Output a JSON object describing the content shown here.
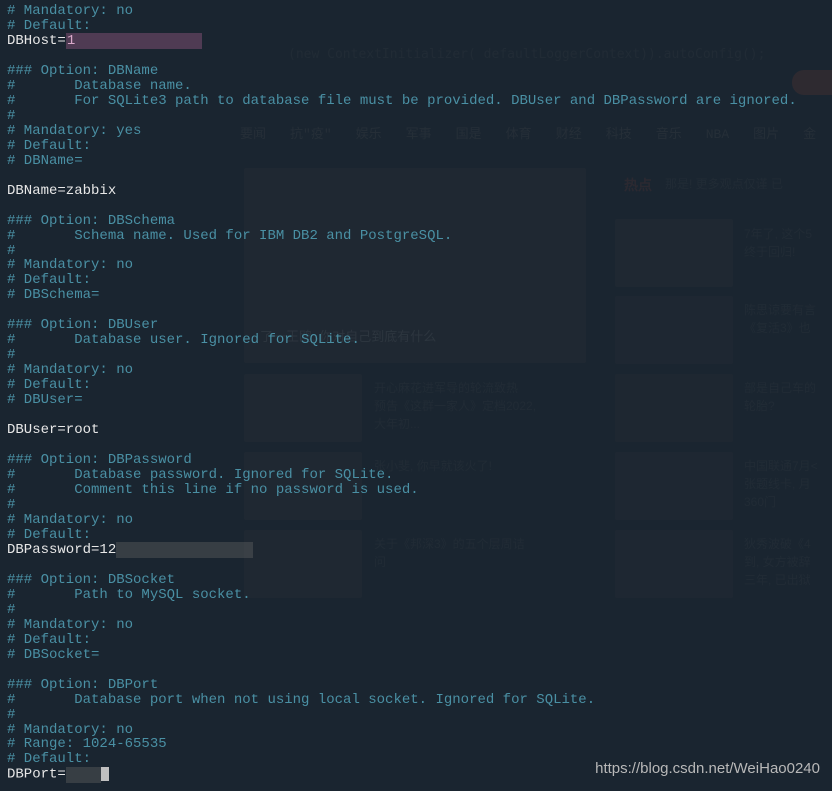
{
  "config": {
    "l1": "# Mandatory: no",
    "l2": "# Default:",
    "l3a": "DBHost=",
    "l3b": "1",
    "l4": "",
    "l5": "### Option: DBName",
    "l6": "#       Database name.",
    "l7": "#       For SQLite3 path to database file must be provided. DBUser and DBPassword are ignored.",
    "l8": "#",
    "l9": "# Mandatory: yes",
    "l10": "# Default:",
    "l11": "# DBName=",
    "l12": "",
    "l13": "DBName=zabbix",
    "l14": "",
    "l15": "### Option: DBSchema",
    "l16": "#       Schema name. Used for IBM DB2 and PostgreSQL.",
    "l17": "#",
    "l18": "# Mandatory: no",
    "l19": "# Default:",
    "l20": "# DBSchema=",
    "l21": "",
    "l22": "### Option: DBUser",
    "l23": "#       Database user. Ignored for SQLite.",
    "l24": "#",
    "l25": "# Mandatory: no",
    "l26": "# Default:",
    "l27": "# DBUser=",
    "l28": "",
    "l29": "DBUser=root",
    "l30": "",
    "l31": "### Option: DBPassword",
    "l32": "#       Database password. Ignored for SQLite.",
    "l33": "#       Comment this line if no password is used.",
    "l34": "#",
    "l35": "# Mandatory: no",
    "l36": "# Default:",
    "l37a": "DBPassword=12",
    "l38": "",
    "l39": "### Option: DBSocket",
    "l40": "#       Path to MySQL socket.",
    "l41": "#",
    "l42": "# Mandatory: no",
    "l43": "# Default:",
    "l44": "# DBSocket=",
    "l45": "",
    "l46": "### Option: DBPort",
    "l47": "#       Database port when not using local socket. Ignored for SQLite.",
    "l48": "#",
    "l49": "# Mandatory: no",
    "l50": "# Range: 1024-65535",
    "l51": "# Default:",
    "l52a": "DBPort="
  },
  "bg": {
    "nav1": "要闻",
    "nav2": "抗\"疫\"",
    "nav3": "娱乐",
    "nav4": "军事",
    "nav5": "国是",
    "nav6": "体育",
    "nav7": "财经",
    "nav8": "科技",
    "nav9": "音乐",
    "nav10": "NBA",
    "nav11": "图片",
    "nav12": "金",
    "hot": "热点",
    "hotText": "那是! 更多观点仅谨 已",
    "caption1": "7年了, 这个5",
    "caption1b": "终于回归!",
    "caption2": "陈思谅要有言",
    "caption2b": "《复活3》也",
    "bigCaption": "了一王鸥, 你对自己到底有什么",
    "caption3": "开心麻花进军导的轮流致热",
    "caption3b": "预告《这群一家人》定档2022,",
    "caption3c": "大年初...",
    "caption4": "部是自己车的",
    "caption4b": "轮胎?",
    "caption5": "张小斐, 你早就该火了!",
    "caption6": "中国联通7月<",
    "caption6b": "张题线卡, 月",
    "caption6c": "360门",
    "caption7": "关于《邦深3》的五个层周诘",
    "caption7b": "问",
    "caption8": "狄秀波破《4",
    "caption8b": "到, 女方被辞",
    "caption8c": "三年, 已出狱",
    "ctxInit": "(new ContextInitializer(      defaultLoggerContext)).autoConfig();"
  },
  "watermark": "https://blog.csdn.net/WeiHao0240"
}
